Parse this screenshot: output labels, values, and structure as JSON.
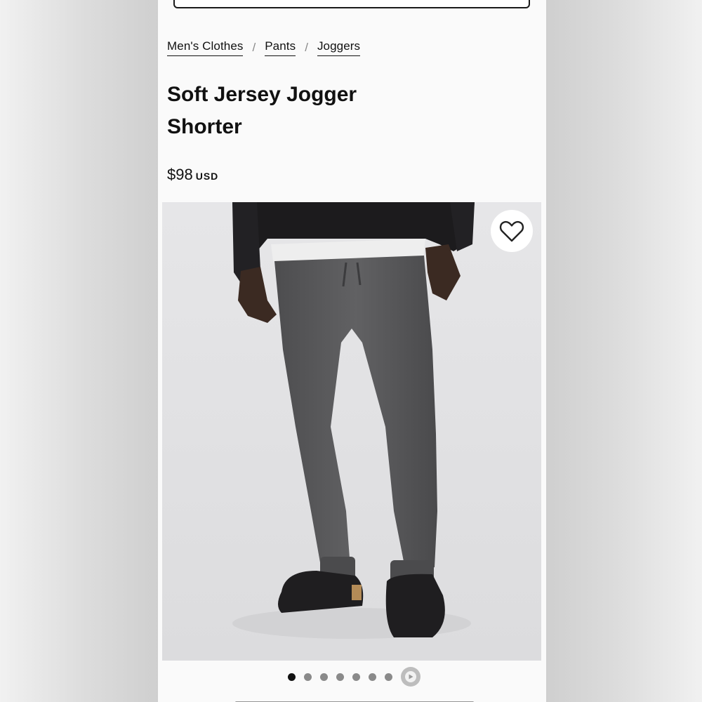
{
  "breadcrumb": [
    {
      "label": "Men's Clothes"
    },
    {
      "label": "Pants"
    },
    {
      "label": "Joggers"
    }
  ],
  "breadcrumb_separator": "/",
  "product": {
    "title_line1": "Soft Jersey Jogger",
    "title_line2": "Shorter",
    "price": "$98",
    "currency": "USD"
  },
  "gallery": {
    "image_count": 7,
    "active_index": 0,
    "has_video": true
  },
  "icons": {
    "wishlist": "heart-icon",
    "video": "video-thumb-icon"
  },
  "colors": {
    "accent": "#111111",
    "page_bg": "#fafafa",
    "image_bg": "#e4e4e6",
    "pants": "#5a5a5c",
    "jacket": "#1c1b1d"
  }
}
